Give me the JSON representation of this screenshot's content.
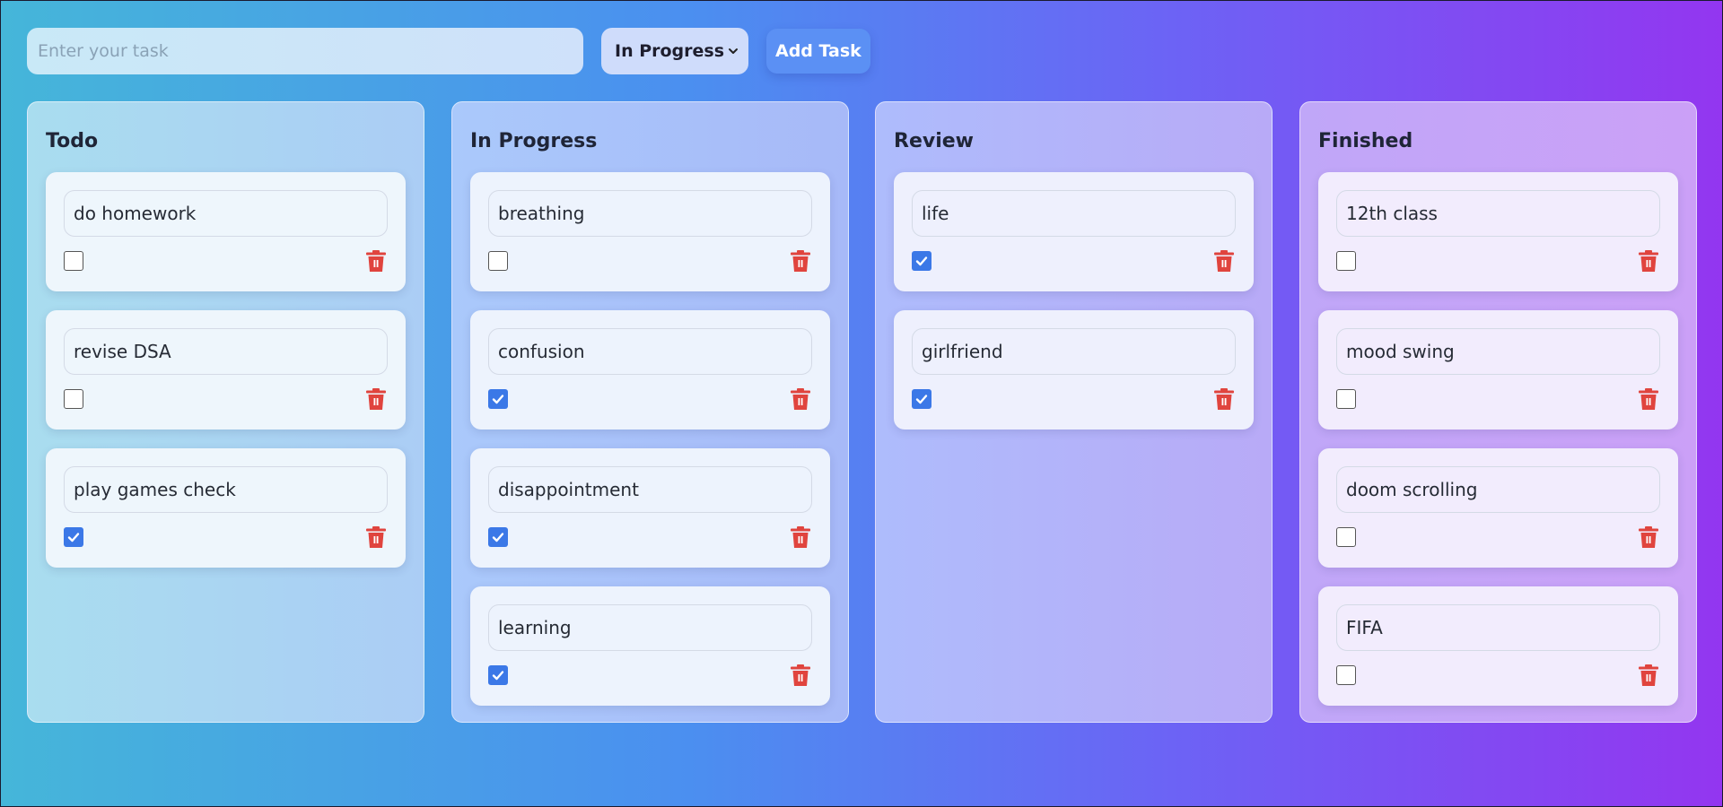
{
  "toolbar": {
    "task_placeholder": "Enter your task",
    "status_selected": "In Progress",
    "add_label": "Add Task"
  },
  "icons": {
    "dropdown": "chevron-down-icon",
    "delete": "trash-icon",
    "check": "checkmark-icon"
  },
  "colors": {
    "delete": "#e0443e",
    "checkbox_checked": "#3b78e7",
    "add_button": "#5b90f4"
  },
  "columns": [
    {
      "title": "Todo",
      "tasks": [
        {
          "text": "do homework",
          "done": false
        },
        {
          "text": "revise DSA",
          "done": false
        },
        {
          "text": "play games check",
          "done": true
        }
      ]
    },
    {
      "title": "In Progress",
      "tasks": [
        {
          "text": "breathing",
          "done": false
        },
        {
          "text": "confusion",
          "done": true
        },
        {
          "text": "disappointment",
          "done": true
        },
        {
          "text": "learning",
          "done": true
        }
      ]
    },
    {
      "title": "Review",
      "tasks": [
        {
          "text": "life",
          "done": true
        },
        {
          "text": "girlfriend",
          "done": true
        }
      ]
    },
    {
      "title": "Finished",
      "tasks": [
        {
          "text": "12th class",
          "done": false
        },
        {
          "text": "mood swing",
          "done": false
        },
        {
          "text": "doom scrolling",
          "done": false
        },
        {
          "text": "FIFA",
          "done": false
        }
      ]
    }
  ]
}
